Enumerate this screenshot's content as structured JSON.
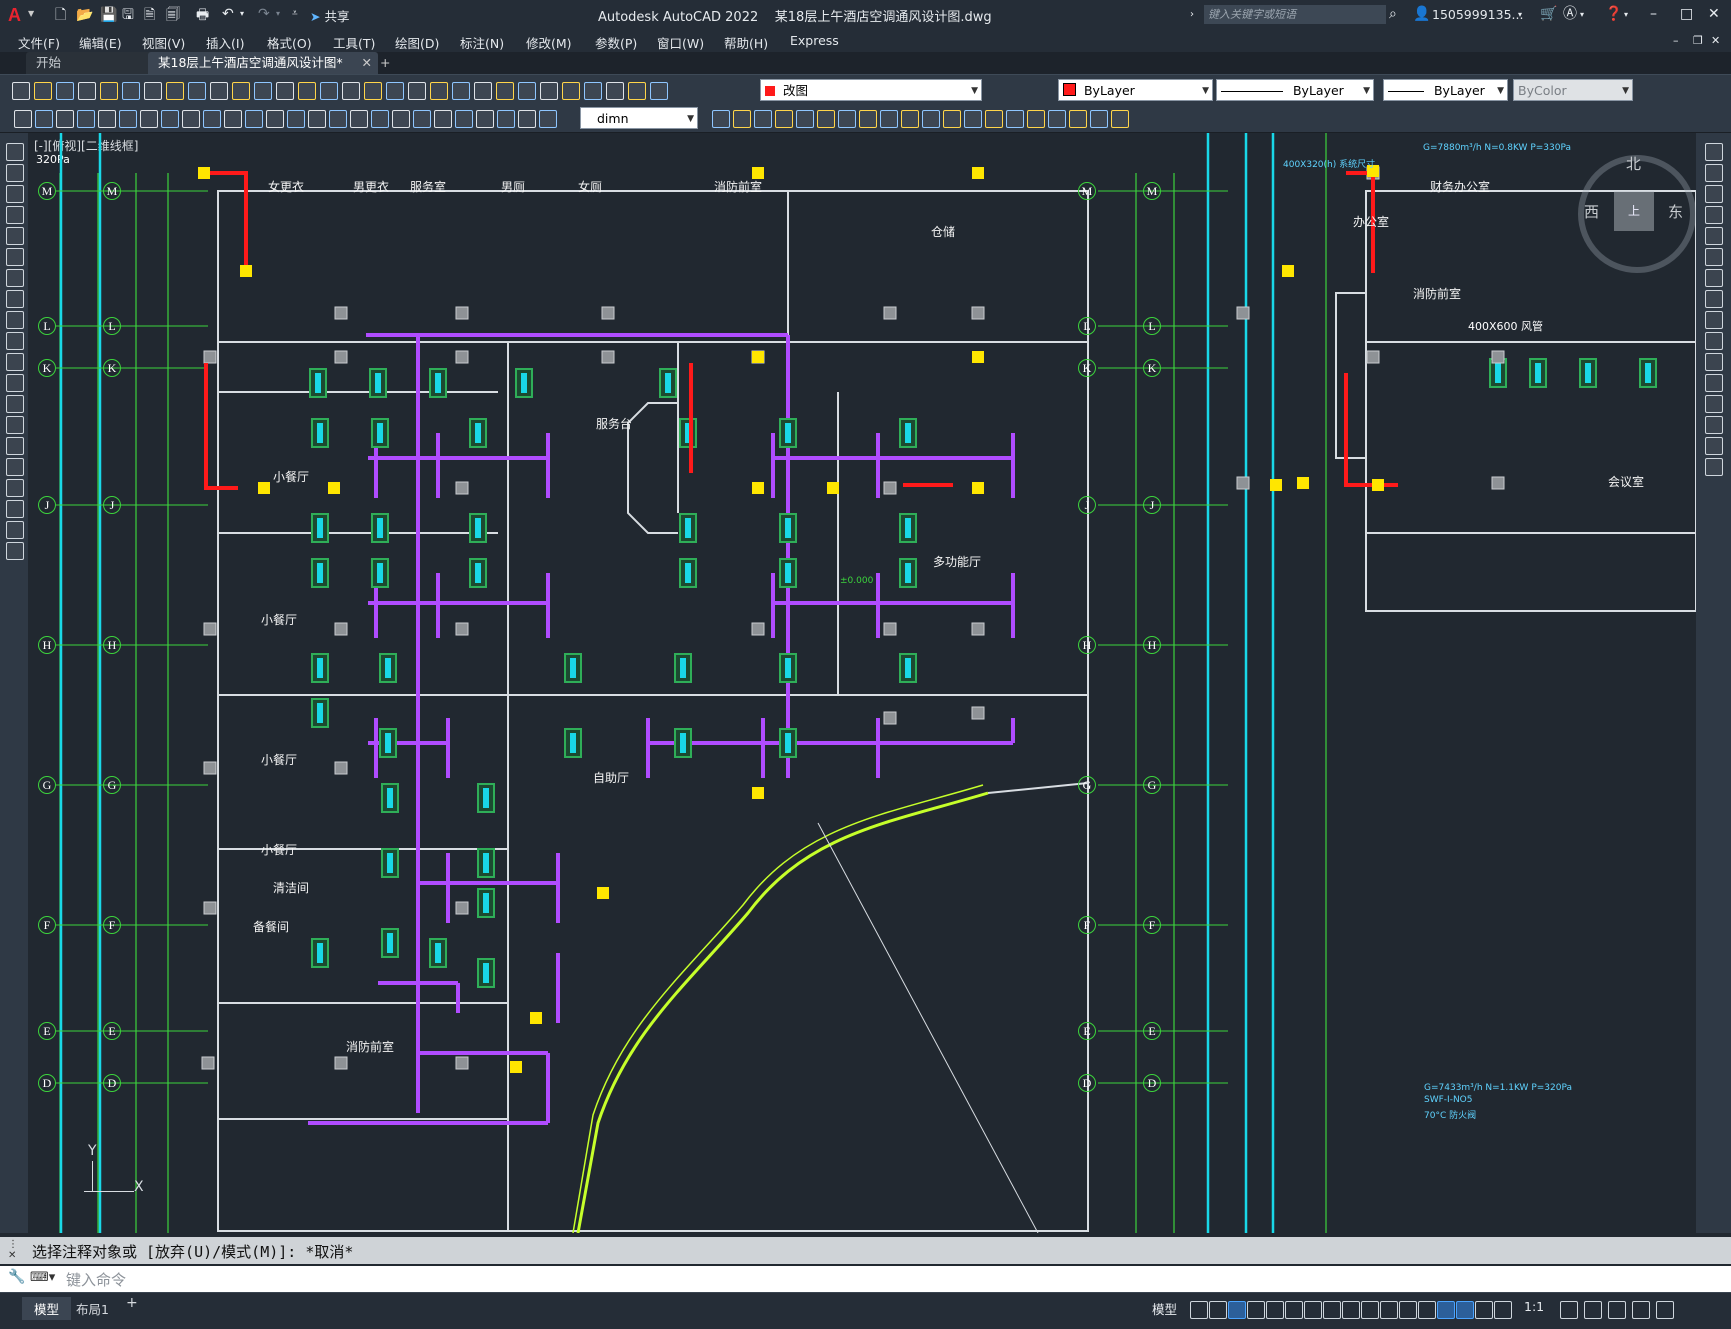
{
  "window": {
    "title": "Autodesk AutoCAD 2022    某18层上午酒店空调通风设计图.dwg",
    "share_label": "共享",
    "search_placeholder": "键入关键字或短语",
    "user": "1505999135...",
    "controls": [
      "–",
      "□",
      "✕"
    ]
  },
  "menu": [
    "文件(F)",
    "编辑(E)",
    "视图(V)",
    "插入(I)",
    "格式(O)",
    "工具(T)",
    "绘图(D)",
    "标注(N)",
    "修改(M)",
    "参数(P)",
    "窗口(W)",
    "帮助(H)",
    "Express"
  ],
  "tabs": [
    {
      "label": "开始",
      "active": false
    },
    {
      "label": "某18层上午酒店空调通风设计图*",
      "active": true
    }
  ],
  "toolbar": {
    "layer": "改图",
    "color": "ByLayer",
    "linetype": "ByLayer",
    "lineweight": "ByLayer",
    "plotstyle": "ByColor",
    "dimstyle": "dimn"
  },
  "viewport": {
    "label": "[-][俯视][二维线框]",
    "scale_note": "320Pa",
    "compass": {
      "north": "北",
      "west": "西",
      "east": "东",
      "top": "上"
    }
  },
  "axes_left": [
    "M",
    "L",
    "K",
    "J",
    "H",
    "G",
    "F",
    "E",
    "D"
  ],
  "rooms": [
    "女更衣",
    "男更衣",
    "服务室",
    "男厕",
    "女厕",
    "消防前室",
    "仓储",
    "服务台",
    "小餐厅",
    "小餐厅",
    "小餐厅",
    "小餐厅",
    "多功能厅",
    "自助厅",
    "清洁间",
    "备餐间",
    "消防前室",
    "办公室",
    "财务办公室",
    "消防前室",
    "会议室"
  ],
  "annotations": [
    "400X320(h) 系统尺寸",
    "G=7880m³/h N=0.8KW P=330Pa",
    "400X600 风管",
    "G=7433m³/h N=1.1KW P=320Pa",
    "SWF-I-NO5",
    "70°C 防火阀",
    "±0.000"
  ],
  "command": {
    "history": "选择注释对象或 [放弃(U)/模式(M)]: *取消*",
    "placeholder": "键入命令"
  },
  "status": {
    "layout_tabs": [
      "模型",
      "布局1"
    ],
    "add_tab": "+",
    "model_label": "模型",
    "scale": "1:1"
  },
  "colors": {
    "wall": "#d8dde2",
    "duct": "#b04cff",
    "grid_green": "#3cd33c",
    "grid_cyan": "#19d8e8",
    "column": "#8e9296",
    "yellow": "#ffe600",
    "red": "#ff1a1a",
    "lime": "#c6ff2a",
    "unit": "#2fae58"
  }
}
